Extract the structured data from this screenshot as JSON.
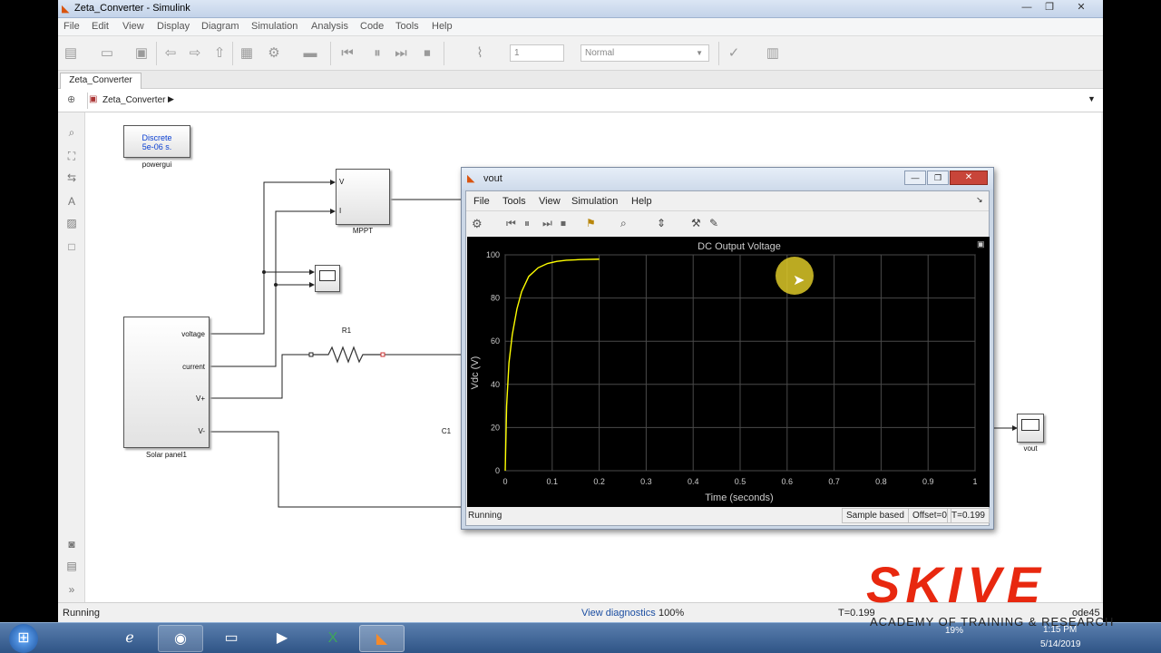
{
  "window": {
    "title": "Zeta_Converter - Simulink",
    "controls": [
      "—",
      "❐",
      "✕"
    ]
  },
  "menubar": [
    "File",
    "Edit",
    "View",
    "Display",
    "Diagram",
    "Simulation",
    "Analysis",
    "Code",
    "Tools",
    "Help"
  ],
  "toolbar": {
    "stop_time": "1",
    "sim_mode": "Normal"
  },
  "tab": {
    "label": "Zeta_Converter"
  },
  "address": {
    "path": "Zeta_Converter"
  },
  "blocks": {
    "powergui": {
      "line1": "Discrete",
      "line2": "5e-06 s.",
      "label": "powergui"
    },
    "mppt": {
      "label": "MPPT",
      "port_v": "V",
      "port_i": "I"
    },
    "solar": {
      "label": "Solar panel1",
      "ports": [
        "voltage",
        "current",
        "V+",
        "V-"
      ]
    },
    "r1": {
      "label": "R1"
    },
    "c1": {
      "label": "C1"
    },
    "vout": {
      "label": "vout"
    }
  },
  "status": {
    "left": "Running",
    "diag": "View diagnostics",
    "zoom": "100%",
    "time": "T=0.199",
    "solver": "ode45"
  },
  "scope": {
    "title": "vout",
    "menu": [
      "File",
      "Tools",
      "View",
      "Simulation",
      "Help"
    ],
    "status_left": "Running",
    "status_sample": "Sample based",
    "status_offset": "Offset=0",
    "status_time": "T=0.199"
  },
  "chart_data": {
    "type": "line",
    "title": "DC Output Voltage",
    "xlabel": "Time (seconds)",
    "ylabel": "Vdc (V)",
    "xlim": [
      0,
      1
    ],
    "ylim": [
      0,
      100
    ],
    "xticks": [
      "0",
      "0.1",
      "0.2",
      "0.3",
      "0.4",
      "0.5",
      "0.6",
      "0.7",
      "0.8",
      "0.9",
      "1"
    ],
    "yticks": [
      "0",
      "20",
      "40",
      "60",
      "80",
      "100"
    ],
    "grid": true,
    "series": [
      {
        "color": "#ffff00",
        "x": [
          0,
          0.003,
          0.008,
          0.015,
          0.025,
          0.035,
          0.05,
          0.07,
          0.09,
          0.11,
          0.13,
          0.16,
          0.2
        ],
        "y": [
          0,
          30,
          50,
          63,
          75,
          83,
          90,
          94,
          96,
          97,
          97.5,
          97.8,
          98
        ]
      }
    ]
  },
  "taskbar": {
    "clock_time": "1:15 PM",
    "clock_date": "5/14/2019",
    "battery": "19%"
  },
  "watermark": {
    "brand": "SKIVE",
    "tagline": "ACADEMY OF TRAINING & RESEARCH"
  }
}
